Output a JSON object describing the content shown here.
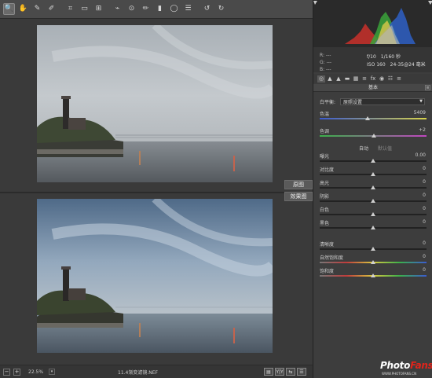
{
  "toolbar": {
    "tools": [
      {
        "name": "zoom-tool",
        "icon": "🔍"
      },
      {
        "name": "hand-tool",
        "icon": "✋"
      },
      {
        "name": "white-balance-tool",
        "icon": "✎"
      },
      {
        "name": "color-sampler-tool",
        "icon": "✐"
      },
      {
        "name": "crop-tool",
        "icon": "⌗"
      },
      {
        "name": "straighten-tool",
        "icon": "▭"
      },
      {
        "name": "transform-tool",
        "icon": "⊞"
      },
      {
        "name": "spot-removal-tool",
        "icon": "⌁"
      },
      {
        "name": "red-eye-tool",
        "icon": "⊙"
      },
      {
        "name": "adjustment-brush-tool",
        "icon": "✏"
      },
      {
        "name": "graduated-filter-tool",
        "icon": "▮"
      },
      {
        "name": "radial-filter-tool",
        "icon": "◯"
      },
      {
        "name": "preferences-tool",
        "icon": "☰"
      },
      {
        "name": "rotate-left-tool",
        "icon": "↺"
      },
      {
        "name": "rotate-right-tool",
        "icon": "↻"
      }
    ],
    "export_icon": "⇥"
  },
  "preview": {
    "before_label": "原图",
    "after_label": "效果图"
  },
  "statusbar": {
    "minus": "−",
    "plus": "+",
    "zoom": "22.5%",
    "filename": "11.4渐变滤镜.NEF",
    "view_icons": [
      "▤",
      "Y|Y",
      "⇆",
      "☰"
    ]
  },
  "info": {
    "r": "R:   ---",
    "g": "G:   ---",
    "b": "B:   ---",
    "aperture": "f/10",
    "shutter": "1/160 秒",
    "iso": "ISO 160",
    "lens": "24-35@24 毫米"
  },
  "panel": {
    "tab_icons": [
      "◎",
      "▲",
      "▲",
      "▬",
      "▦",
      "≡",
      "fx",
      "◉",
      "☷",
      "≡"
    ],
    "section_title": "基本",
    "wb_label": "白平衡:",
    "wb_value": "原照设置",
    "auto_label": "自动",
    "default_label": "默认值",
    "controls_wb": [
      {
        "label": "色温",
        "value": "5409",
        "pos": 0.45
      },
      {
        "label": "色调",
        "value": "+2",
        "pos": 0.51
      }
    ],
    "controls_tone": [
      {
        "label": "曝光",
        "value": "0.00",
        "pos": 0.5
      },
      {
        "label": "对比度",
        "value": "0",
        "pos": 0.5
      },
      {
        "label": "高光",
        "value": "0",
        "pos": 0.5
      },
      {
        "label": "阴影",
        "value": "0",
        "pos": 0.5
      },
      {
        "label": "白色",
        "value": "0",
        "pos": 0.5
      },
      {
        "label": "黑色",
        "value": "0",
        "pos": 0.5
      }
    ],
    "controls_presence": [
      {
        "label": "清晰度",
        "value": "0",
        "pos": 0.5
      },
      {
        "label": "自然饱和度",
        "value": "0",
        "pos": 0.5
      },
      {
        "label": "饱和度",
        "value": "0",
        "pos": 0.5
      }
    ]
  },
  "watermark": {
    "brand_a": "Photo",
    "brand_b": "Fans",
    "url": "WWW.PHOTOFANS.CN"
  }
}
